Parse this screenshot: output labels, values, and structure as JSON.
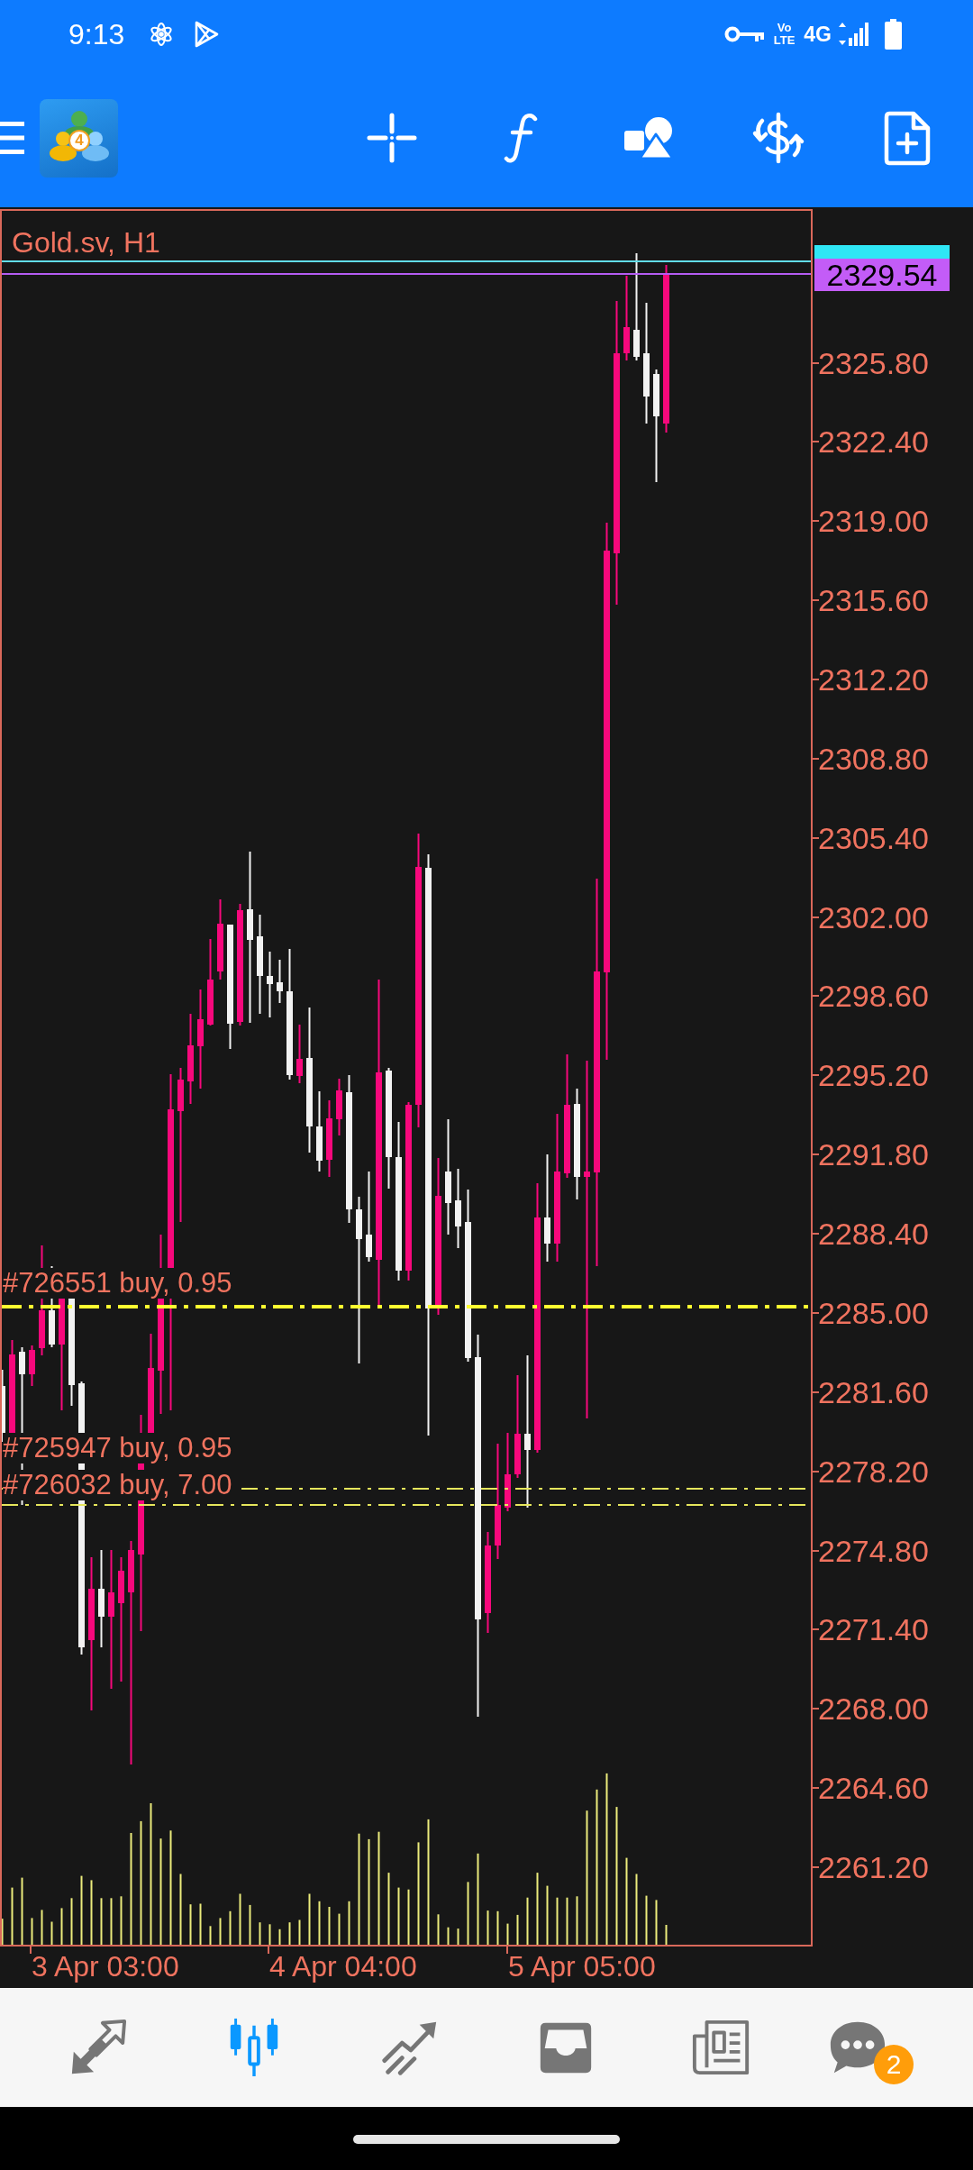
{
  "status_bar": {
    "time": "9:13",
    "volte_top": "Vo",
    "volte_bottom": "LTE",
    "network": "4G"
  },
  "toolbar": {
    "logo_badge": "4"
  },
  "chart": {
    "title": "Gold.sv, H1",
    "price_tags": [
      {
        "kind": "ask"
      },
      {
        "kind": "bid",
        "label": "2329.54"
      }
    ],
    "order_lines": [
      {
        "label": "#726551 buy, 0.95",
        "kind": "thick"
      },
      {
        "label": "#725947 buy, 0.95",
        "kind": "thin"
      },
      {
        "label": "#726032 buy, 7.00",
        "kind": "thin"
      }
    ],
    "price_axis": [
      "2325.80",
      "2322.40",
      "2319.00",
      "2315.60",
      "2312.20",
      "2308.80",
      "2305.40",
      "2302.00",
      "2298.60",
      "2295.20",
      "2291.80",
      "2288.40",
      "2285.00",
      "2281.60",
      "2278.20",
      "2274.80",
      "2271.40",
      "2268.00",
      "2264.60",
      "2261.20"
    ],
    "time_axis": [
      "3 Apr 03:00",
      "4 Apr 04:00",
      "5 Apr 05:00"
    ]
  },
  "bottom_nav": [
    {
      "selected": false
    },
    {
      "selected": true
    },
    {
      "selected": false
    },
    {
      "selected": false
    },
    {
      "selected": false
    },
    {
      "selected": false,
      "badge": "2"
    }
  ]
}
